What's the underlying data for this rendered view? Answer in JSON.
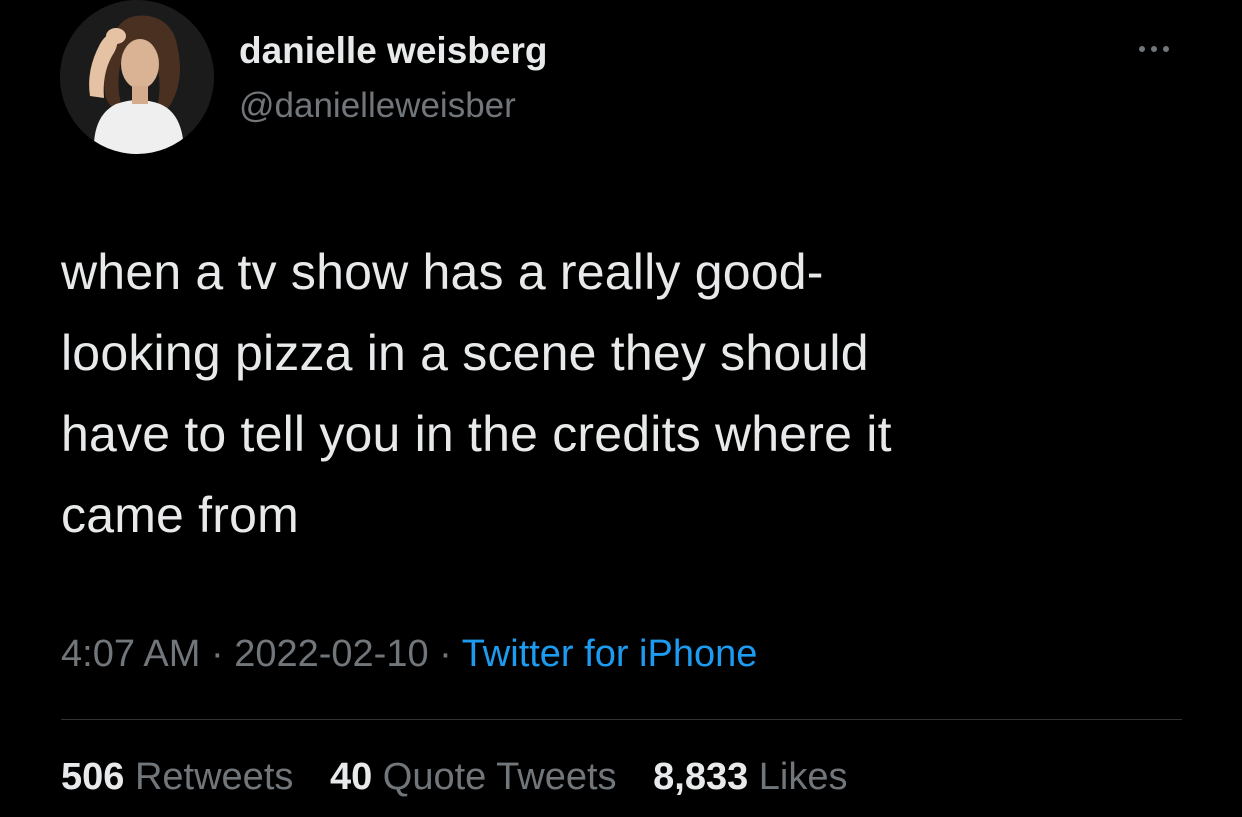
{
  "author": {
    "display_name": "danielle weisberg",
    "handle": "@danielleweisber"
  },
  "tweet": {
    "text_lines": [
      "when a tv show has a really good-",
      "looking pizza in a scene they should",
      "have to tell you in the credits where it",
      "came from"
    ],
    "time": "4:07 AM",
    "separator": "·",
    "date": "2022-02-10",
    "source": "Twitter for iPhone"
  },
  "stats": {
    "retweets_count": "506",
    "retweets_label": "Retweets",
    "quotes_count": "40",
    "quotes_label": "Quote Tweets",
    "likes_count": "8,833",
    "likes_label": "Likes"
  },
  "icons": {
    "more": "more-horizontal-icon"
  },
  "colors": {
    "background": "#000000",
    "primary_text": "#e7e9ea",
    "secondary_text": "#71767b",
    "link": "#1d9bf0",
    "divider": "#2f3336"
  }
}
